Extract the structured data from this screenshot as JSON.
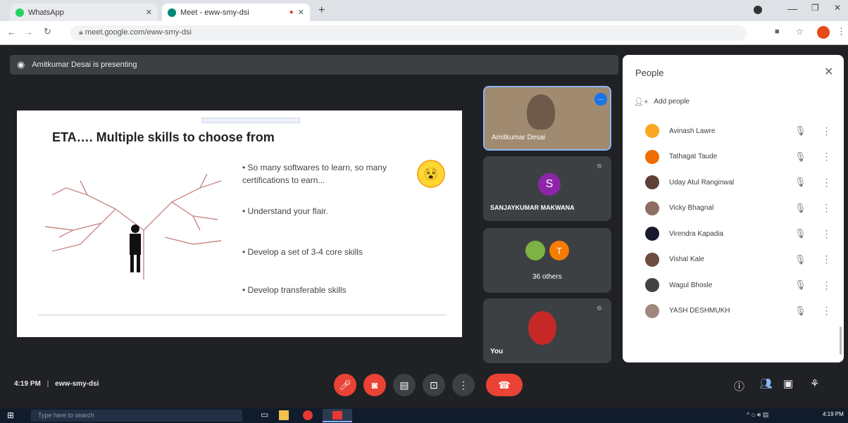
{
  "browser": {
    "tabs": [
      {
        "label": "WhatsApp",
        "color": "#25d366"
      },
      {
        "label": "Meet - eww-smy-dsi",
        "color": "#00897b"
      }
    ],
    "new_tab": "+",
    "url": "meet.google.com/eww-smy-dsi"
  },
  "meet": {
    "presenting_text": "Amitkumar Desai is presenting",
    "slide": {
      "title": "ETA…. Multiple skills to choose from",
      "bullets": [
        "So many softwares to learn, so many certifications to earn...",
        "Understand your flair.",
        "Develop a set of 3-4 core skills",
        "Develop transferable skills"
      ]
    },
    "tiles": [
      {
        "label": "Amitkumar Desai"
      },
      {
        "label": "SANJAYKUMAR MAKWANA",
        "initial": "S",
        "color": "#8e24aa"
      },
      {
        "label": "36 others",
        "initial": "T",
        "color": "#f57c00"
      },
      {
        "label": "You"
      }
    ],
    "time": "4:19 PM",
    "meeting_code": "eww-smy-dsi"
  },
  "people": {
    "title": "People",
    "add_people": "Add people",
    "list": [
      {
        "name": "Avinash Lawre",
        "color": "#f9a825"
      },
      {
        "name": "Tathagat Taude",
        "color": "#ef6c00"
      },
      {
        "name": "Uday Atul Ranginwal",
        "color": "#5d4037"
      },
      {
        "name": "Vicky Bhagnal",
        "color": "#8d6e63"
      },
      {
        "name": "Virendra Kapadia",
        "color": "#1a1a2e"
      },
      {
        "name": "Vishal Kale",
        "color": "#6d4c41"
      },
      {
        "name": "Wagul Bhosle",
        "color": "#424242"
      },
      {
        "name": "YASH DESHMUKH",
        "color": "#a1887f"
      }
    ]
  },
  "taskbar": {
    "search_placeholder": "Type here to search",
    "clock": "4:19 PM"
  }
}
